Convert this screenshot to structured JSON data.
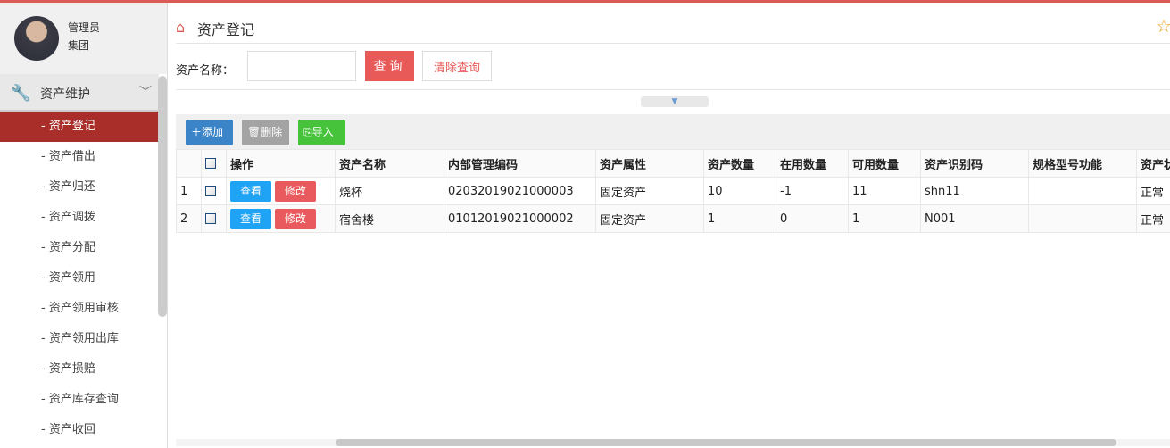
{
  "user": {
    "name": "管理员",
    "group": "集团"
  },
  "sidebar": {
    "section": "资产维护",
    "items": [
      {
        "label": "- 资产登记",
        "active": true
      },
      {
        "label": "- 资产借出"
      },
      {
        "label": "- 资产归还"
      },
      {
        "label": "- 资产调拨"
      },
      {
        "label": "- 资产分配"
      },
      {
        "label": "- 资产领用"
      },
      {
        "label": "- 资产领用审核"
      },
      {
        "label": "- 资产领用出库"
      },
      {
        "label": "- 资产损赔"
      },
      {
        "label": "- 资产库存查询"
      },
      {
        "label": "- 资产收回"
      }
    ]
  },
  "page": {
    "title": "资产登记"
  },
  "search": {
    "label": "资产名称：",
    "value": "",
    "query_label": "查询",
    "clear_label": "清除查询"
  },
  "toolbar": {
    "add": "添加",
    "delete": "删除",
    "import": "导入"
  },
  "table": {
    "headers": [
      "",
      "",
      "操作",
      "资产名称",
      "内部管理编码",
      "资产属性",
      "资产数量",
      "在用数量",
      "可用数量",
      "资产识别码",
      "规格型号功能",
      "资产状态"
    ],
    "view_label": "查看",
    "edit_label": "修改",
    "rows": [
      [
        "1",
        "烧杯",
        "02032019021000003",
        "固定资产",
        "10",
        "-1",
        "11",
        "shn11",
        "",
        "正常"
      ],
      [
        "2",
        "宿舍楼",
        "01012019021000002",
        "固定资产",
        "1",
        "0",
        "1",
        "N001",
        "",
        "正常"
      ]
    ]
  },
  "colors": {
    "accent": "#dc5a55",
    "active_menu": "#a92e2a",
    "add": "#3c84c8",
    "import": "#46c33a",
    "view": "#1fa3f5",
    "edit": "#e85a5e"
  }
}
